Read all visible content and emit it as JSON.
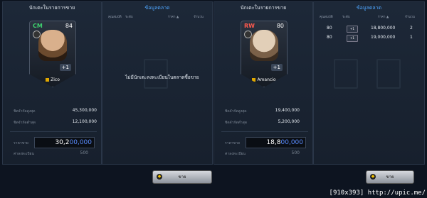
{
  "left": {
    "header": "นักเตะในรายการขาย",
    "card": {
      "position": "CM",
      "position_color": "#3ed16f",
      "rating": "84",
      "plus": "+1",
      "name": "Zico"
    },
    "stats": [
      {
        "label": "ชิดจำกัดสูงสุด",
        "value": "45,300,000"
      },
      {
        "label": "ชิดจำกัดต่ำสุด",
        "value": "12,100,000"
      }
    ],
    "price_label": "ราคาขาย",
    "price_typed": "30,2",
    "price_placeholder": "00,000",
    "fee_label": "ค่าลงทะเบียน",
    "fee_value": "500"
  },
  "market1": {
    "header": "ข้อมูลตลาด",
    "columns": [
      "คุณสมบัติ",
      "ระดับ",
      "ราคา ▲",
      "จำนวน"
    ],
    "empty_message": "ไม่มีนักเตะลงทะเบียนในตลาดซื้อขาย"
  },
  "right": {
    "header": "นักเตะในรายการขาย",
    "card": {
      "position": "RW",
      "position_color": "#ff5a4e",
      "rating": "80",
      "plus": "+1",
      "name": "Amancio"
    },
    "stats": [
      {
        "label": "ชิดจำกัดสูงสุด",
        "value": "19,400,000"
      },
      {
        "label": "ชิดจำกัดต่ำสุด",
        "value": "5,200,000"
      }
    ],
    "price_label": "ราคาขาย",
    "price_typed": "18,8",
    "price_placeholder": "00,000",
    "fee_label": "ค่าลงทะเบียน",
    "fee_value": "500"
  },
  "market2": {
    "header": "ข้อมูลตลาด",
    "columns": [
      "คุณสมบัติ",
      "ระดับ",
      "ราคา ▲",
      "จำนวน"
    ],
    "rows": [
      {
        "ovr": "80",
        "level": "+1",
        "price": "18,800,000",
        "qty": "2"
      },
      {
        "ovr": "80",
        "level": "+1",
        "price": "19,000,000",
        "qty": "1"
      }
    ]
  },
  "buttons": {
    "sell1": "ขาย",
    "sell2": "ขาย"
  },
  "watermark": "[910x393] http://upic.me/"
}
